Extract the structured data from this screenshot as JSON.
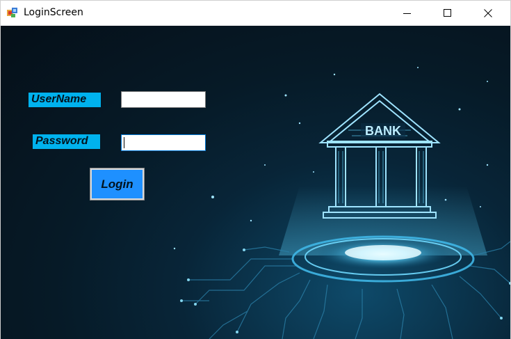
{
  "window": {
    "title": "LoginScreen",
    "icons": {
      "app": "app-icon",
      "minimize": "minimize-icon",
      "maximize": "maximize-icon",
      "close": "close-icon"
    }
  },
  "form": {
    "username_label": "UserName",
    "password_label": "Password",
    "username_value": "",
    "password_value": "",
    "login_label": "Login"
  },
  "background": {
    "sign_text": "BANK",
    "illustration": "bank-hologram-circuit-illustration"
  },
  "colors": {
    "label_bg": "#00b2ee",
    "button_bg": "#1e90ff",
    "background_dark": "#061a27",
    "glow": "#5fd6ff"
  }
}
